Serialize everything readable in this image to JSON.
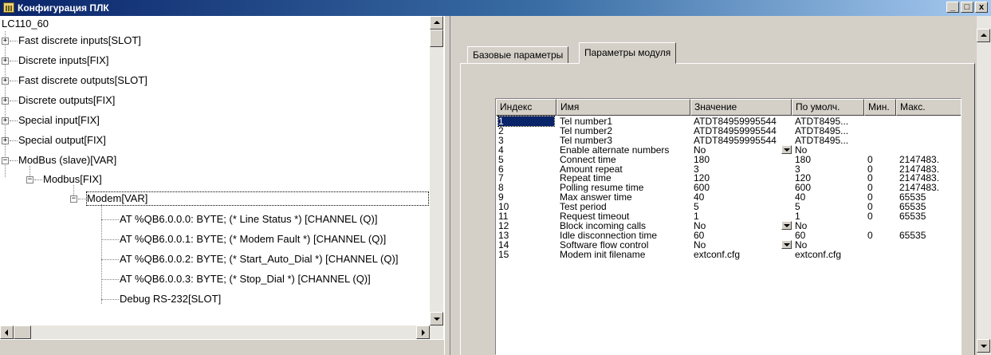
{
  "window": {
    "title": "Конфигурация ПЛК",
    "min_glyph": "_",
    "max_glyph": "□",
    "close_glyph": "x"
  },
  "tree": {
    "root": "LC110_60",
    "nodes": [
      "Fast discrete inputs[SLOT]",
      "Discrete inputs[FIX]",
      "Fast discrete outputs[SLOT]",
      "Discrete outputs[FIX]",
      "Special input[FIX]",
      "Special output[FIX]",
      "ModBus (slave)[VAR]",
      "Modbus[FIX]",
      "Modem[VAR]",
      "AT %QB6.0.0.0: BYTE; (* Line Status *) [CHANNEL (Q)]",
      "AT %QB6.0.0.1: BYTE; (* Modem Fault *) [CHANNEL (Q)]",
      "AT %QB6.0.0.2: BYTE; (* Start_Auto_Dial *) [CHANNEL (Q)]",
      "AT %QB6.0.0.3: BYTE; (* Stop_Dial *) [CHANNEL (Q)]",
      "Debug RS-232[SLOT]"
    ],
    "expand_plus": "+",
    "expand_minus": "−"
  },
  "tabs": [
    "Базовые параметры",
    "Параметры модуля"
  ],
  "active_tab": "Параметры модуля",
  "grid": {
    "headers": [
      "Индекс",
      "Имя",
      "Значение",
      "По умолч.",
      "Мин.",
      "Макс."
    ],
    "rows": [
      {
        "idx": "1",
        "name": "Tel number1",
        "value": "ATDT84959995544",
        "def": "ATDT8495...",
        "min": "",
        "max": ""
      },
      {
        "idx": "2",
        "name": "Tel number2",
        "value": "ATDT84959995544",
        "def": "ATDT8495...",
        "min": "",
        "max": ""
      },
      {
        "idx": "3",
        "name": "Tel number3",
        "value": "ATDT84959995544",
        "def": "ATDT8495...",
        "min": "",
        "max": ""
      },
      {
        "idx": "4",
        "name": "Enable alternate numbers",
        "value": "No",
        "def": "No",
        "min": "",
        "max": ""
      },
      {
        "idx": "5",
        "name": "Connect time",
        "value": "180",
        "def": "180",
        "min": "0",
        "max": "2147483."
      },
      {
        "idx": "6",
        "name": "Amount repeat",
        "value": "3",
        "def": "3",
        "min": "0",
        "max": "2147483."
      },
      {
        "idx": "7",
        "name": "Repeat time",
        "value": "120",
        "def": "120",
        "min": "0",
        "max": "2147483."
      },
      {
        "idx": "8",
        "name": "Polling resume time",
        "value": "600",
        "def": "600",
        "min": "0",
        "max": "2147483."
      },
      {
        "idx": "9",
        "name": "Max answer time",
        "value": "40",
        "def": "40",
        "min": "0",
        "max": "65535"
      },
      {
        "idx": "10",
        "name": "Test period",
        "value": "5",
        "def": "5",
        "min": "0",
        "max": "65535"
      },
      {
        "idx": "11",
        "name": "Request timeout",
        "value": "1",
        "def": "1",
        "min": "0",
        "max": "65535"
      },
      {
        "idx": "12",
        "name": "Block incoming calls",
        "value": "No",
        "def": "No",
        "min": "",
        "max": ""
      },
      {
        "idx": "13",
        "name": "Idle disconnection time",
        "value": "60",
        "def": "60",
        "min": "0",
        "max": "65535"
      },
      {
        "idx": "14",
        "name": "Software flow control",
        "value": "No",
        "def": "No",
        "min": "",
        "max": ""
      },
      {
        "idx": "15",
        "name": "Modem init filename",
        "value": "extconf.cfg",
        "def": "extconf.cfg",
        "min": "",
        "max": ""
      }
    ]
  },
  "colors": {
    "title_start": "#0a246a",
    "title_end": "#a6caf0",
    "face": "#d4d0c8",
    "selection": "#0a246a"
  }
}
